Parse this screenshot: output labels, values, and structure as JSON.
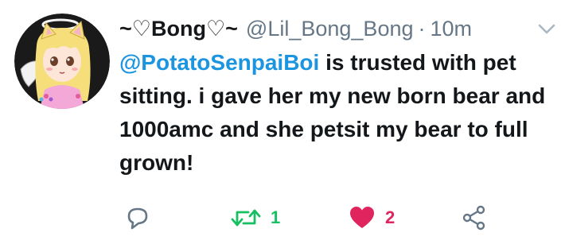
{
  "tweet": {
    "display_name": "~♡Bong♡~",
    "handle": "@Lil_Bong_Bong",
    "separator": "·",
    "time": "10m",
    "mention": "@PotatoSenpaiBoi",
    "text": " is trusted with pet sitting. i gave her my new born bear and 1000amc and she petsit my bear to full grown!"
  },
  "actions": {
    "reply": {
      "icon": "reply-icon"
    },
    "retweet": {
      "icon": "retweet-icon",
      "count": "1",
      "color": "#17bf63"
    },
    "like": {
      "icon": "heart-icon",
      "count": "2",
      "color": "#e0245e"
    },
    "share": {
      "icon": "share-icon"
    }
  },
  "colors": {
    "link": "#1b95e0",
    "muted": "#657786",
    "text": "#14171a"
  }
}
